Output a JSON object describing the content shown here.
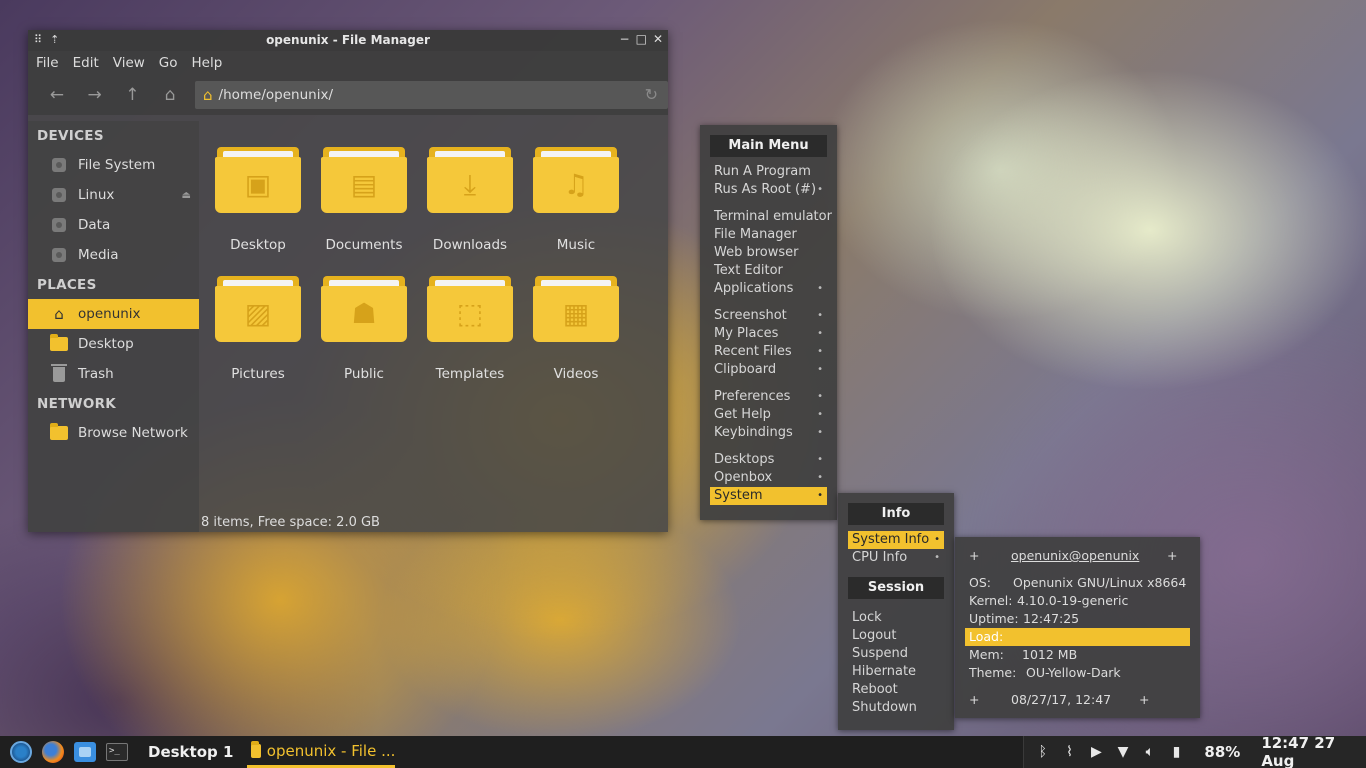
{
  "file_manager": {
    "title": "openunix - File Manager",
    "menus": [
      "File",
      "Edit",
      "View",
      "Go",
      "Help"
    ],
    "location": "/home/openunix/",
    "sidebar": {
      "devices_header": "DEVICES",
      "devices": [
        "File System",
        "Linux",
        "Data",
        "Media"
      ],
      "places_header": "PLACES",
      "places": [
        "openunix",
        "Desktop",
        "Trash"
      ],
      "network_header": "NETWORK",
      "network": [
        "Browse Network"
      ]
    },
    "folders": [
      {
        "label": "Desktop",
        "icon": "monitor-icon"
      },
      {
        "label": "Documents",
        "icon": "document-icon"
      },
      {
        "label": "Downloads",
        "icon": "download-icon"
      },
      {
        "label": "Music",
        "icon": "music-icon"
      },
      {
        "label": "Pictures",
        "icon": "picture-icon"
      },
      {
        "label": "Public",
        "icon": "people-icon"
      },
      {
        "label": "Templates",
        "icon": "template-icon"
      },
      {
        "label": "Videos",
        "icon": "film-icon"
      }
    ],
    "status": "8 items, Free space: 2.0 GB"
  },
  "main_menu": {
    "header": "Main Menu",
    "items": [
      "Run A Program",
      "Rus As Root (#)",
      "Terminal emulator",
      "File Manager",
      "Web browser",
      "Text Editor",
      "Applications",
      "Screenshot",
      "My Places",
      "Recent Files",
      "Clipboard",
      "Preferences",
      "Get Help",
      "Keybindings",
      "Desktops",
      "Openbox",
      "System"
    ]
  },
  "system_menu": {
    "info_header": "Info",
    "info_items": [
      "System Info",
      "CPU Info"
    ],
    "session_header": "Session",
    "session_items": [
      "Lock",
      "Logout",
      "Suspend",
      "Hibernate",
      "Reboot",
      "Shutdown"
    ]
  },
  "sysinfo": {
    "user_host": "openunix@openunix",
    "plus": "+",
    "os_label": "OS:",
    "os_value": "Openunix GNU/Linux x8664",
    "kernel_label": "Kernel:",
    "kernel_value": "4.10.0-19-generic",
    "uptime_label": "Uptime:",
    "uptime_value": "12:47:25",
    "load_label": "Load:",
    "mem_label": "Mem:",
    "mem_value": "1012 MB",
    "theme_label": "Theme:",
    "theme_value": "OU-Yellow-Dark",
    "datetime": "08/27/17, 12:47"
  },
  "panel": {
    "desktop": "Desktop 1",
    "task": "openunix - File ...",
    "battery": "88%",
    "clock": "12:47 27 Aug"
  },
  "colors": {
    "accent": "#f2c12e",
    "panel": "#1f1f1f",
    "window": "#484848"
  }
}
